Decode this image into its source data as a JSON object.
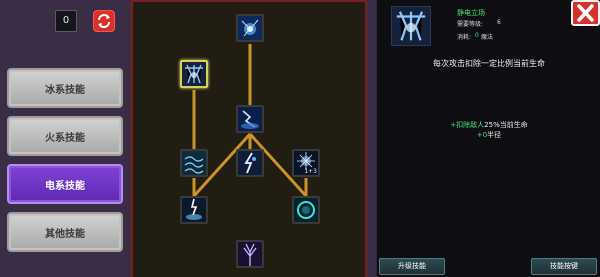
{
  "skill_points": "0",
  "tabs": [
    {
      "label": "冰系技能",
      "active": false
    },
    {
      "label": "火系技能",
      "active": false
    },
    {
      "label": "电系技能",
      "active": true
    },
    {
      "label": "其他技能",
      "active": false
    }
  ],
  "tree": {
    "nodes": [
      {
        "name": "skill-node-top",
        "icon": "lightning-orb-icon",
        "selected": false
      },
      {
        "name": "skill-node-static-field",
        "icon": "static-field-icon",
        "selected": true
      },
      {
        "name": "skill-node-storm-center",
        "icon": "lightning-storm-icon",
        "selected": false
      },
      {
        "name": "skill-node-chain-left",
        "icon": "chain-lightning-icon",
        "selected": false
      },
      {
        "name": "skill-node-bolt-middle",
        "icon": "lightning-bolt-icon",
        "selected": false
      },
      {
        "name": "skill-node-spark-right",
        "icon": "spark-burst-icon",
        "selected": false,
        "level": "1+3"
      },
      {
        "name": "skill-node-thunder-left",
        "icon": "thunder-strike-icon",
        "selected": false
      },
      {
        "name": "skill-node-orb-right",
        "icon": "energy-orb-icon",
        "selected": false
      },
      {
        "name": "skill-node-bottom",
        "icon": "lightning-tree-icon",
        "selected": false
      }
    ]
  },
  "detail": {
    "skill_name": "静电立场",
    "req_label": "需要等级:",
    "req_value": "6",
    "cost_label": "消耗:",
    "cost_value": "0",
    "cost_unit": "魔法",
    "description": "每次攻击扣除一定比例当前生命",
    "effect1_prefix": "+扣除敌人",
    "effect1_value": "25%",
    "effect1_suffix": "当前生命",
    "effect2_value": "+0",
    "effect2_suffix": "半径"
  },
  "buttons": {
    "upgrade": "升级技能",
    "hotkey": "技能按键"
  },
  "colors": {
    "accent_green": "#4ee07a",
    "tab_active": "#6a32c4",
    "close_red": "#d6322c",
    "link_line": "#c9952a"
  }
}
